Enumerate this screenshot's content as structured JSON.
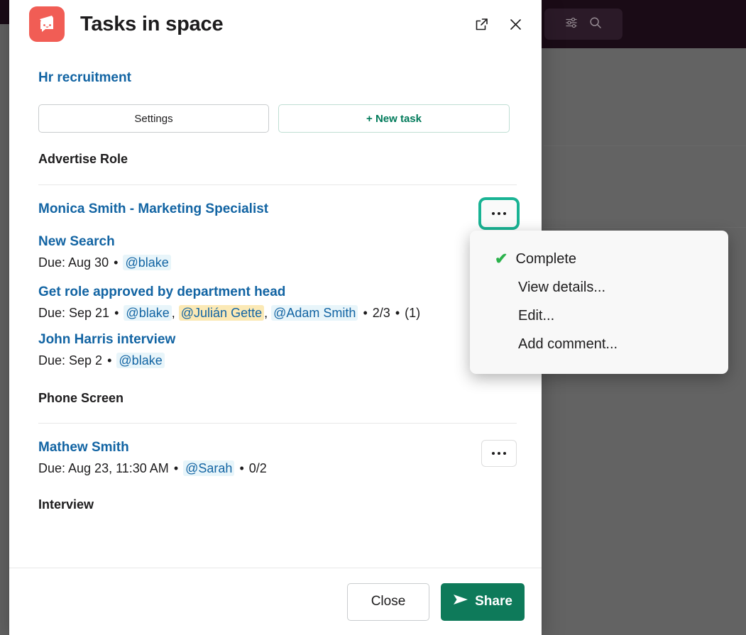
{
  "backdrop": {
    "icons": [
      "sliders-icon",
      "search-icon"
    ]
  },
  "modal": {
    "app_icon_name": "tasks-app-icon",
    "title": "Tasks in space",
    "header_actions": [
      {
        "name": "open-in-new-window-icon",
        "label": "Open in new window"
      },
      {
        "name": "close-icon",
        "label": "Close"
      }
    ],
    "space_link": "Hr recruitment",
    "buttons": {
      "settings": "Settings",
      "new_task": "+ New task"
    },
    "sections": [
      {
        "title": "Advertise Role",
        "tasks": [
          {
            "title": "Monica Smith - Marketing Specialist",
            "meta": null,
            "kebab": "•••",
            "kebab_focused": true
          },
          {
            "title": "New Search",
            "due_label": "Due: Aug 30",
            "assignees": [
              {
                "name": "@blake",
                "me": false
              }
            ],
            "kebab": null
          },
          {
            "title": "Get role approved by department head",
            "due_label": "Due: Sep 21",
            "assignees": [
              {
                "name": "@blake",
                "me": false
              },
              {
                "name": "@Julián Gette",
                "me": true
              },
              {
                "name": "@Adam Smith",
                "me": false
              }
            ],
            "progress": "2/3",
            "comments": "(1)",
            "kebab": null
          },
          {
            "title": "John Harris interview",
            "due_label": "Due: Sep 2",
            "assignees": [
              {
                "name": "@blake",
                "me": false
              }
            ],
            "kebab": "•••",
            "kebab_focused": false
          }
        ]
      },
      {
        "title": "Phone Screen",
        "tasks": [
          {
            "title": "Mathew Smith",
            "due_label": "Due: Aug 23, 11:30 AM",
            "assignees": [
              {
                "name": "@Sarah",
                "me": false
              }
            ],
            "progress": "0/2",
            "kebab": "•••",
            "kebab_focused": false
          }
        ]
      },
      {
        "title": "Interview",
        "tasks": []
      }
    ],
    "footer": {
      "close": "Close",
      "share": "Share",
      "share_icon": "send-icon"
    }
  },
  "context_menu": {
    "items": [
      {
        "label": "Complete",
        "icon": "check-icon",
        "checked": true
      },
      {
        "label": "View details...",
        "icon": null,
        "checked": false
      },
      {
        "label": "Edit...",
        "icon": null,
        "checked": false
      },
      {
        "label": "Add comment...",
        "icon": null,
        "checked": false
      }
    ]
  },
  "colors": {
    "accent_green": "#007a5a",
    "link_blue": "#1264a3",
    "app_icon_red": "#f15d55",
    "focus_ring": "#19b394",
    "mention_bg": "#e8f5fa",
    "mention_me_bg": "#fbe9b5",
    "share_green": "#0e7a5a",
    "check_green": "#2bb24c"
  },
  "separators": {
    "bullet": "•",
    "comma": ","
  }
}
